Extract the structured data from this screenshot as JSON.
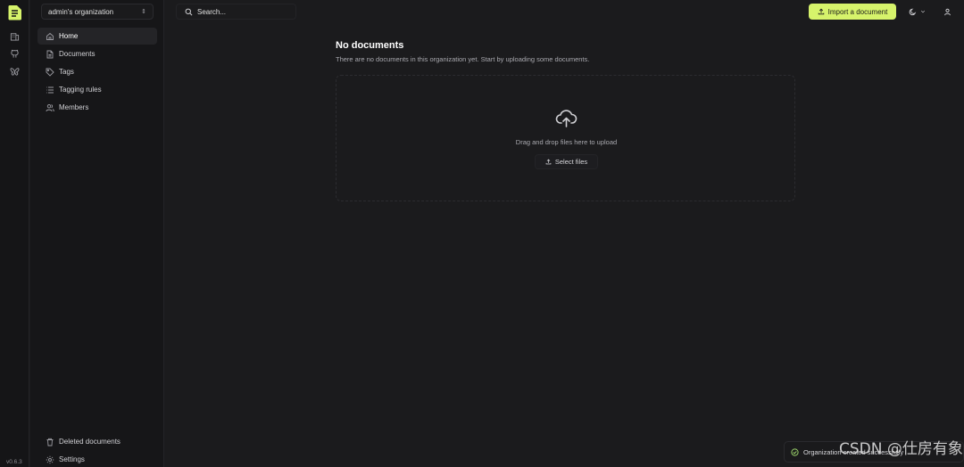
{
  "rail": {
    "version": "v0.6.3",
    "icons": [
      "logo-icon",
      "building-icon",
      "github-icon",
      "butterfly-icon"
    ]
  },
  "sidebar": {
    "org": "admin's organization",
    "items": [
      {
        "label": "Home",
        "icon": "home-icon",
        "active": true
      },
      {
        "label": "Documents",
        "icon": "file-icon"
      },
      {
        "label": "Tags",
        "icon": "tag-icon"
      },
      {
        "label": "Tagging rules",
        "icon": "list-icon"
      },
      {
        "label": "Members",
        "icon": "users-icon"
      }
    ],
    "bottom": [
      {
        "label": "Deleted documents",
        "icon": "trash-icon"
      },
      {
        "label": "Settings",
        "icon": "gear-icon"
      }
    ]
  },
  "topbar": {
    "search_label": "Search...",
    "import_label": "Import a document",
    "accent": "#d6f36b"
  },
  "main": {
    "title": "No documents",
    "subtitle": "There are no documents in this organization yet. Start by uploading some documents.",
    "drop_text": "Drag and drop files here to upload",
    "select_label": "Select files"
  },
  "toast": {
    "text": "Organization created successfully"
  },
  "watermark": "CSDN @仕房有象"
}
